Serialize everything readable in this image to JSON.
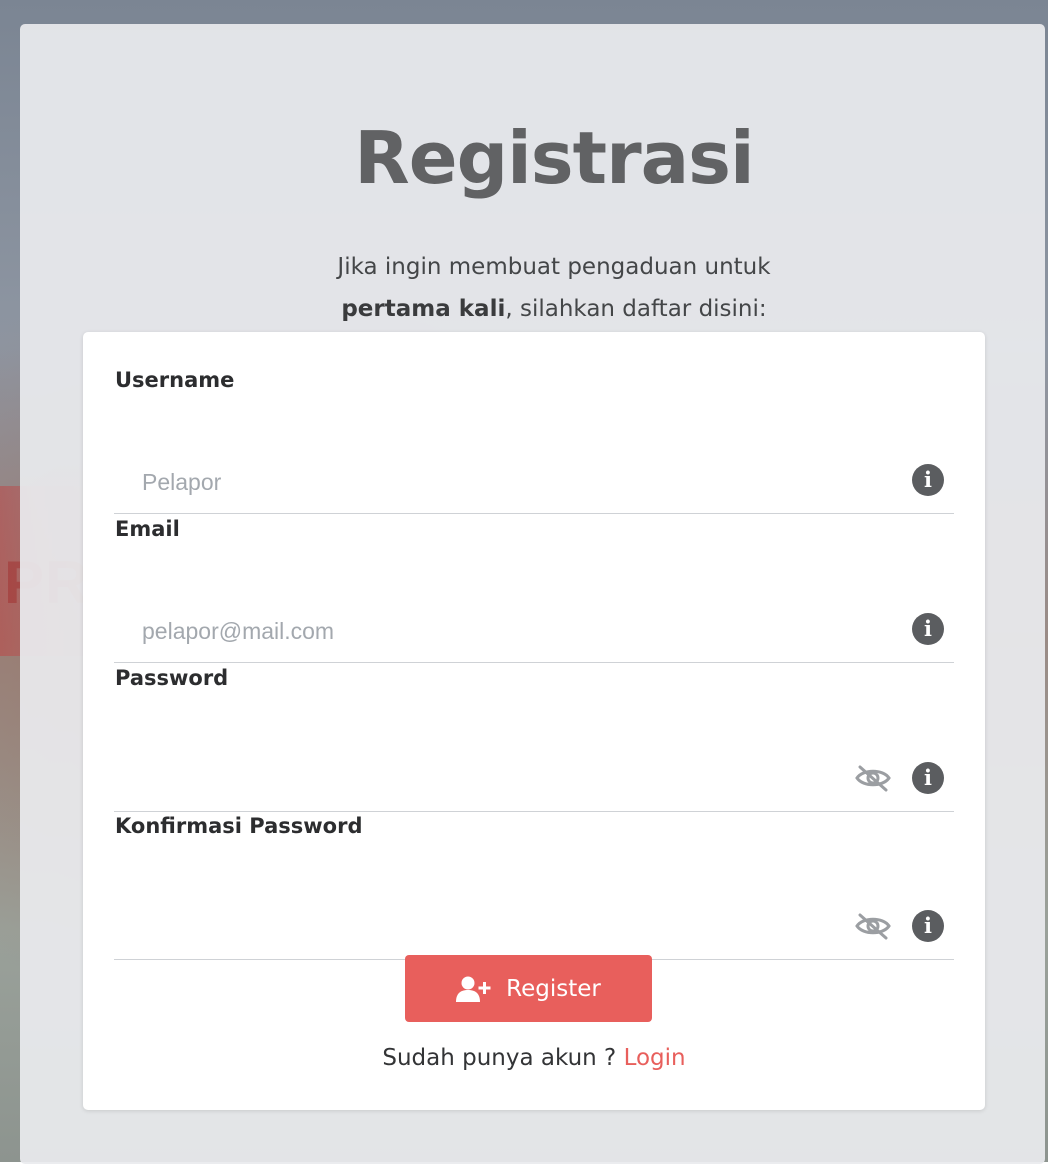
{
  "header": {
    "title": "Registrasi",
    "subtitle_line1": "Jika ingin membuat pengaduan untuk",
    "subtitle_bold": "pertama kali",
    "subtitle_rest": ", silahkan daftar disini:"
  },
  "form": {
    "fields": [
      {
        "label": "Username",
        "placeholder": "Pelapor",
        "value": "",
        "type": "text"
      },
      {
        "label": "Email",
        "placeholder": "pelapor@mail.com",
        "value": "",
        "type": "email"
      },
      {
        "label": "Password",
        "placeholder": "",
        "value": "",
        "type": "password"
      },
      {
        "label": "Konfirmasi Password",
        "placeholder": "",
        "value": "",
        "type": "password"
      }
    ],
    "register_label": "Register",
    "login_prompt": "Sudah punya akun ? ",
    "login_link": "Login"
  },
  "icons": {
    "info": "info-circle-icon",
    "eye": "eye-slash-icon",
    "user_plus": "user-plus-icon"
  },
  "colors": {
    "accent": "#e85f5c",
    "title": "#616264",
    "icon": "#5b5d60"
  },
  "background_text": "PR"
}
